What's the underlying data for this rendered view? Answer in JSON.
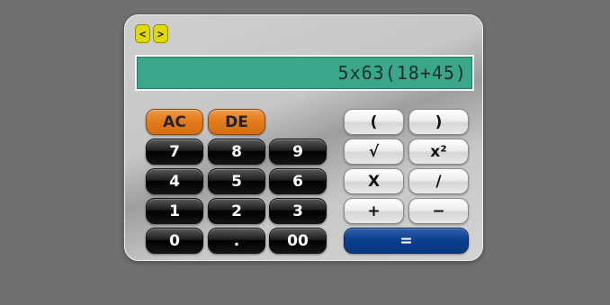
{
  "colors": {
    "background": "#707070",
    "display_bg": "#3aa68a",
    "nav_button": "#e1d800",
    "orange_button": "#e27a1c",
    "equals_button": "#0b3f8f"
  },
  "nav": {
    "back_label": "<",
    "forward_label": ">"
  },
  "display": {
    "value": "5x63(18+45)"
  },
  "keys": {
    "ac": "AC",
    "de": "DE",
    "seven": "7",
    "eight": "8",
    "nine": "9",
    "four": "4",
    "five": "5",
    "six": "6",
    "one": "1",
    "two": "2",
    "three": "3",
    "zero": "0",
    "dot": ".",
    "double_zero": "00",
    "open_paren": "(",
    "close_paren": ")",
    "sqrt": "√",
    "square": "x²",
    "multiply": "X",
    "divide": "/",
    "plus": "+",
    "minus": "−",
    "equals": "="
  }
}
